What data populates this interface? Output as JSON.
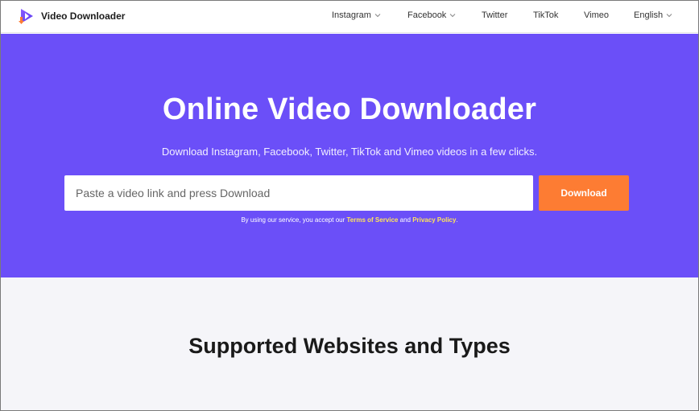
{
  "header": {
    "brand_name": "Video Downloader",
    "nav": [
      {
        "label": "Instagram",
        "dropdown": true
      },
      {
        "label": "Facebook",
        "dropdown": true
      },
      {
        "label": "Twitter",
        "dropdown": false
      },
      {
        "label": "TikTok",
        "dropdown": false
      },
      {
        "label": "Vimeo",
        "dropdown": false
      },
      {
        "label": "English",
        "dropdown": true
      }
    ]
  },
  "hero": {
    "title": "Online Video Downloader",
    "subtitle": "Download Instagram, Facebook, Twitter, TikTok and Vimeo videos in a few clicks.",
    "search_placeholder": "Paste a video link and press Download",
    "download_label": "Download",
    "terms_prefix": "By using our service, you accept our ",
    "terms_link": "Terms of Service",
    "terms_and": " and ",
    "privacy_link": "Privacy Policy",
    "terms_suffix": "."
  },
  "section": {
    "title": "Supported Websites and Types"
  },
  "colors": {
    "hero_bg": "#6b4ff8",
    "accent_orange": "#fd7c33",
    "link_yellow": "#ffe55c"
  },
  "icons": {
    "brand": "play-download-logo-icon",
    "dropdown": "chevron-down-icon"
  }
}
